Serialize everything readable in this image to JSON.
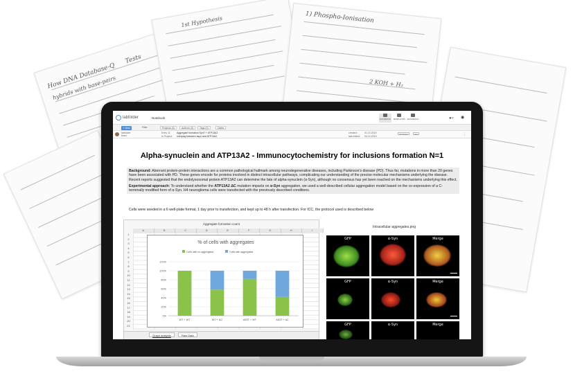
{
  "notes": {
    "sheet1": [
      "How DNA Database-Q",
      "Tests",
      "hybrids with base-pairs"
    ],
    "sheet2": [
      "1st Hypothesis"
    ],
    "sheet3": [
      "1) Phospho-Ionisation",
      "2 KOH + H₂"
    ]
  },
  "app": {
    "logo": "labfolder",
    "notebook_tab": "Notebook",
    "nav": [
      {
        "label": "NOTEBOOK",
        "icon": "notebook-icon"
      },
      {
        "label": "TEMPLATES",
        "icon": "templates-icon"
      },
      {
        "label": "MATERIALS",
        "icon": "materials-icon"
      }
    ],
    "add_button": "+ Add",
    "toolbar": [
      "Filter",
      "Projects (0)",
      "Authors (0)",
      "Tags (0)",
      "Dates"
    ]
  },
  "entry": {
    "author": "labfolder team",
    "entry_label": "Entry 11",
    "entry_title": "Aggregate formation SynT + ATP13A2",
    "project_label": "In Project:",
    "project": "Interplay between asyn and ATP13A2",
    "created_label": "created:",
    "created": "01.10.2019",
    "edited_label": "last edited:",
    "edited": "04.10.2019",
    "tags": [
      "ATP13A2",
      "ICC"
    ]
  },
  "document": {
    "title": "Alpha-synuclein and ATP13A2 - Immunocytochemistry for inclusions formation N=1",
    "background_label": "Background:",
    "background": "Aberrant protein-protein interactions are a common pathological hallmark among neurodegenerative diseases, including Parkinson's disease (PD). Thus far, mutations in more than 20 genes have been associated with PD. These genes encode for proteins involved in distinct intracellular pathways, complicating our understanding of the precise molecular mechanisms underlying the disease. Recent reports suggested that the endolysosomal protein ATP13A2 can determine the fate of alpha-synuclein (α-Syn), although no consensus has yet been reached on the mechanisms underlying this effect.",
    "approach_label": "Experimental approach:",
    "approach_a": "To understand whether the",
    "approach_bold": "ATP13A2 ΔC",
    "approach_b": "mutation impacts on",
    "approach_bold2": "α-Syn",
    "approach_c": "aggregation, we used a well-described cellular aggregation model based on the co-expression of a C-terminally modified form of α-Syn. H4 neuroglioma cells were transfected with the previously described conditions.",
    "cells_text": "Cells were seeded in a 6 well-plate format, 1 day prior to transfection, and kept up to 48 h after transfection. For ICC, the  protocol used is described below"
  },
  "spreadsheet": {
    "title": "Aggregate formation count",
    "columns": [
      "A",
      "B",
      "C",
      "D",
      "E",
      "F",
      "G",
      "H",
      "I"
    ],
    "rows": [
      "1",
      "2",
      "3",
      "4",
      "5",
      "6",
      "7",
      "8",
      "9",
      "10",
      "11",
      "12",
      "13",
      "14",
      "15",
      "16",
      "17",
      "18",
      "19",
      "20",
      "21"
    ],
    "tabs": [
      "Graph analysis",
      "Raw Data"
    ]
  },
  "chart_data": {
    "type": "bar",
    "title": "% of cells with aggregates",
    "categories": [
      "WT + WT",
      "WT + ΔC",
      "A53T + WT",
      "A53T + ΔC"
    ],
    "series": [
      {
        "name": "Cells with no aggregates",
        "color": "#8bc34a",
        "values": [
          100,
          58,
          82,
          42
        ]
      },
      {
        "name": "Cells with aggregates",
        "color": "#6fa8dc",
        "values": [
          0,
          42,
          18,
          58
        ]
      }
    ],
    "stacked": true,
    "ylim": [
      0,
      120
    ],
    "yticks": [
      "0%",
      "20%",
      "40%",
      "60%",
      "80%",
      "100%",
      "120%"
    ],
    "legend": "top"
  },
  "images": {
    "title": "Intracellular aggregates.png",
    "labels": [
      "GFP",
      "α-Syn",
      "Merge"
    ]
  }
}
